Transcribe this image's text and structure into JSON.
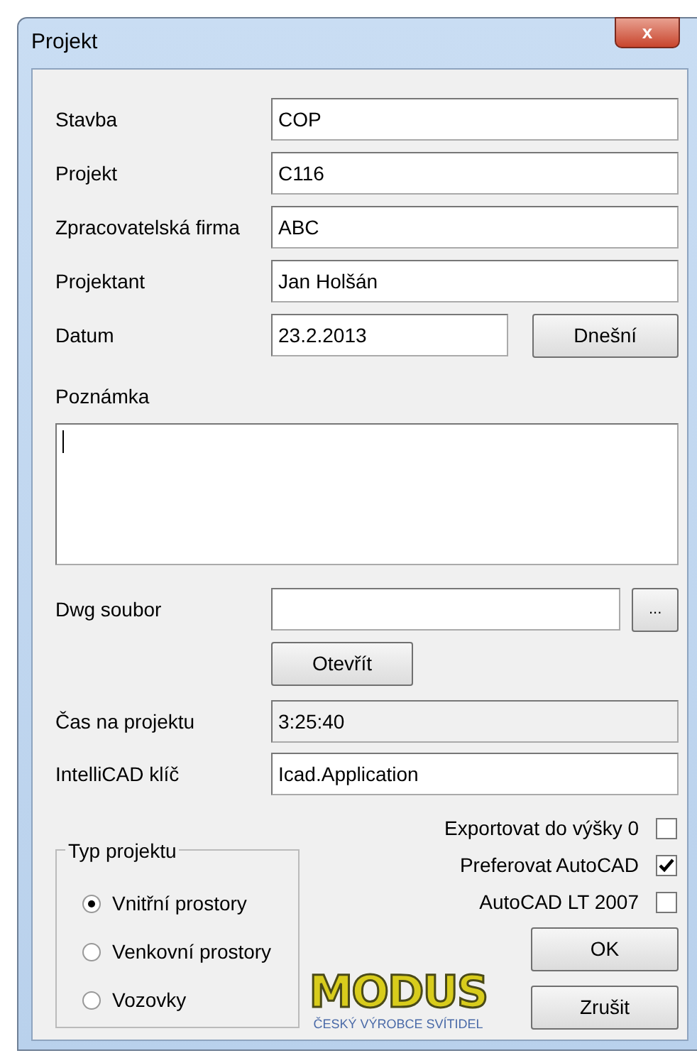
{
  "window": {
    "title": "Projekt",
    "close_label": "x"
  },
  "fields": [
    {
      "label": "Stavba",
      "value": "COP"
    },
    {
      "label": "Projekt",
      "value": "C116"
    },
    {
      "label": "Zpracovatelská firma",
      "value": "ABC"
    },
    {
      "label": "Projektant",
      "value": "Jan Holšán"
    }
  ],
  "date": {
    "label": "Datum",
    "value": "23.2.2013",
    "button": "Dnešní"
  },
  "note": {
    "label": "Poznámka"
  },
  "dwg": {
    "label": "Dwg soubor",
    "browse_button": "...",
    "open_button": "Otevřít"
  },
  "time": {
    "label": "Čas na projektu",
    "value": "3:25:40",
    "disabled": true
  },
  "intellicad": {
    "label": "IntelliCAD klíč",
    "value": "Icad.Application"
  },
  "checkboxes": [
    {
      "label": "Exportovat do výšky 0",
      "checked": false
    },
    {
      "label": "Preferovat AutoCAD",
      "checked": true
    },
    {
      "label": "AutoCAD LT 2007",
      "checked": false
    }
  ],
  "project_type": {
    "title": "Typ projektu",
    "options": [
      {
        "label": "Vnitřní prostory",
        "selected": true
      },
      {
        "label": "Venkovní prostory",
        "selected": false
      },
      {
        "label": "Vozovky",
        "selected": false
      }
    ]
  },
  "logo": {
    "name": "MODUS",
    "tagline": "ČESKÝ VÝROBCE SVÍTIDEL"
  },
  "buttons": [
    {
      "label": "OK"
    },
    {
      "label": "Zrušit"
    }
  ]
}
